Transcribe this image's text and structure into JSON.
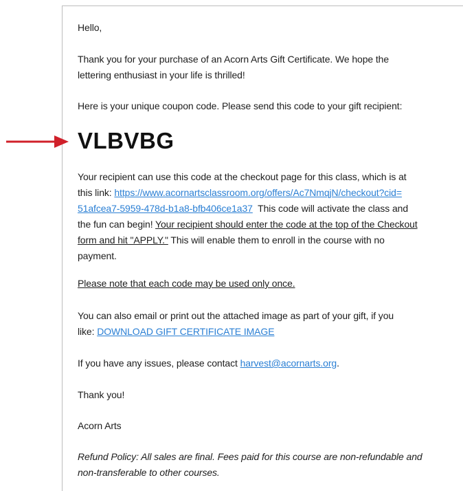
{
  "email": {
    "greeting": "Hello,",
    "intro_line1": "Thank you for your purchase of an Acorn Arts Gift Certificate. We hope the",
    "intro_line2": "lettering enthusiast in your life is thrilled!",
    "code_intro": "Here is your unique coupon code. Please send this code to your gift recipient:",
    "coupon_code": "VLBVBG",
    "recipient_line1": "Your recipient can use this code at the checkout page for this class, which is at",
    "recipient_line2_prefix": "this link: ",
    "checkout_link_part1": "https://www.acornartsclassroom.org/offers/Ac7NmqjN/checkout?cid=",
    "checkout_link_part2": "51afcea7-5959-478d-b1a8-bfb406ce1a37",
    "recipient_line3_suffix": "  This code will activate the class and",
    "recipient_line4_prefix": "the fun can begin! ",
    "recipient_line4_underlined": "Your recipient should enter the code at the top of the Checkout",
    "recipient_line5_underlined": "form and hit \"APPLY.\"",
    "recipient_line5_suffix": " This will enable them to enroll in the course with no",
    "recipient_line6": "payment.",
    "once_note": "Please note that each code may be used only once.",
    "image_line1": "You can also email or print out the attached image as part of your gift, if you",
    "image_line2_prefix": "like: ",
    "download_link": "DOWNLOAD GIFT CERTIFICATE IMAGE",
    "issues_prefix": "If you have any issues, please contact ",
    "contact_email": "harvest@acornarts.org",
    "issues_suffix": ".",
    "thanks": "Thank you!",
    "signature": "Acorn Arts",
    "refund_line1": "Refund Policy: All sales are final. Fees paid for this course are non-refundable and",
    "refund_line2": "non-transferable to other courses."
  },
  "annotation": {
    "arrow_color": "#d0202a",
    "arrow_icon": "right-arrow-icon"
  }
}
